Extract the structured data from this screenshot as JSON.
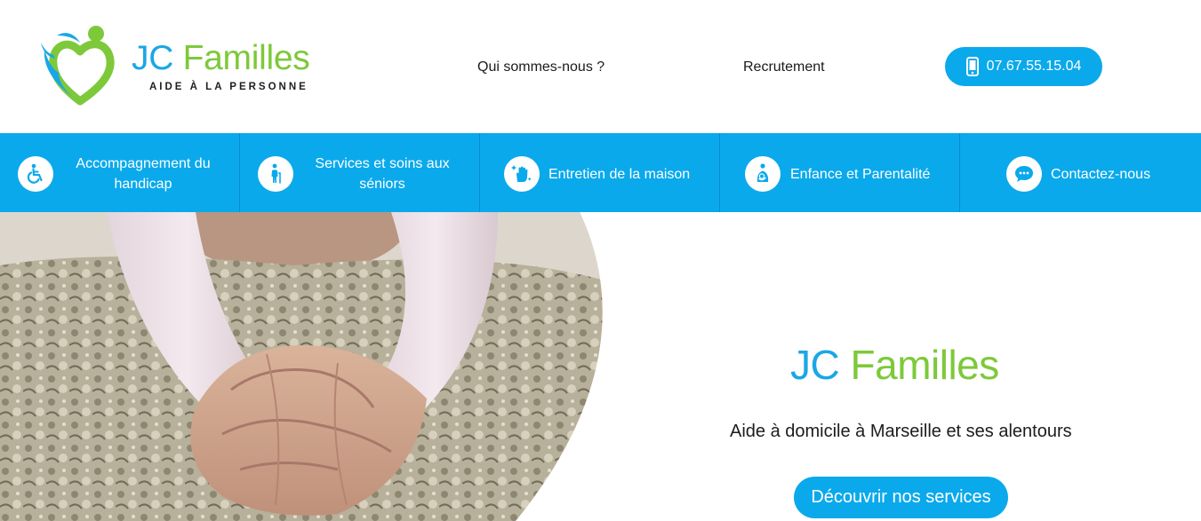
{
  "brand": {
    "name_first": "JC",
    "name_second": "Familles",
    "tagline": "AIDE À LA PERSONNE",
    "colors": {
      "blue": "#1aa7e6",
      "green": "#7dc93a"
    }
  },
  "header": {
    "nav": [
      {
        "label": "Qui sommes-nous ?"
      },
      {
        "label": "Recrutement"
      }
    ],
    "phone": {
      "label": "07.67.55.15.04",
      "icon": "smartphone-icon"
    }
  },
  "services": [
    {
      "label_line1": "Accompagnement du",
      "label_line2": "handicap",
      "icon": "wheelchair-icon"
    },
    {
      "label_line1": "Services et soins aux",
      "label_line2": "séniors",
      "icon": "senior-walking-cane-icon"
    },
    {
      "label": "Entretien de la maison",
      "icon": "cleaning-hand-sparkle-icon"
    },
    {
      "label": "Enfance et Parentalité",
      "icon": "parent-child-icon"
    },
    {
      "label": "Contactez-nous",
      "icon": "chat-bubble-icon"
    }
  ],
  "service_bar_color": "#0aa9ec",
  "hero": {
    "title_first": "JC",
    "title_second": "Familles",
    "subtitle": "Aide à domicile à Marseille et ses alentours",
    "cta_label": "Découvrir nos services"
  }
}
